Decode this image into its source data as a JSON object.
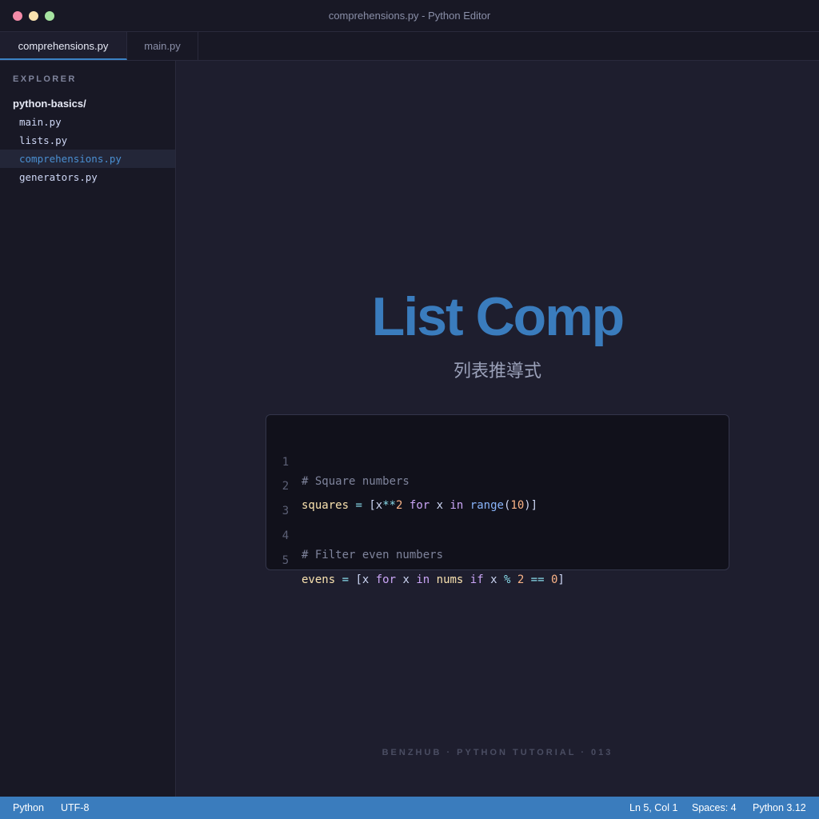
{
  "window": {
    "title": "comprehensions.py - Python Editor"
  },
  "tabs": [
    {
      "label": "comprehensions.py",
      "active": true
    },
    {
      "label": "main.py",
      "active": false
    }
  ],
  "sidebar": {
    "title": "EXPLORER",
    "folder": "python-basics/",
    "files": [
      {
        "label": "main.py",
        "active": false
      },
      {
        "label": "lists.py",
        "active": false
      },
      {
        "label": "comprehensions.py",
        "active": true
      },
      {
        "label": "generators.py",
        "active": false
      }
    ]
  },
  "editor": {
    "title": "List Comp",
    "subtitle": "列表推導式",
    "code": {
      "line_numbers": [
        "1",
        "2",
        "3",
        "4",
        "5"
      ],
      "line1": {
        "comment": "# Square numbers"
      },
      "line2": {
        "var": "squares",
        "eq": " = ",
        "open": "[",
        "x1": "x",
        "pow": "**",
        "two": "2",
        "for": " for ",
        "x2": "x",
        "in": " in ",
        "range": "range",
        "paren_open": "(",
        "ten": "10",
        "close": ")]"
      },
      "line4": {
        "comment": "# Filter even numbers"
      },
      "line5": {
        "var": "evens",
        "eq": " = ",
        "open": "[",
        "x1": "x",
        "for": " for ",
        "x2": "x",
        "in": " in ",
        "nums": "nums",
        "if": " if ",
        "x3": "x",
        "mod": " % ",
        "two": "2",
        "eqeq": " == ",
        "zero": "0",
        "close": "]"
      }
    },
    "credit": "BENZHUB · PYTHON TUTORIAL · 013"
  },
  "statusbar": {
    "language": "Python",
    "encoding": "UTF-8",
    "position": "Ln 5, Col 1",
    "spaces": "Spaces: 4",
    "version": "Python 3.12"
  },
  "colors": {
    "accent": "#3a7cbd",
    "background": "#1e1e2e",
    "sidebar": "#181825"
  }
}
